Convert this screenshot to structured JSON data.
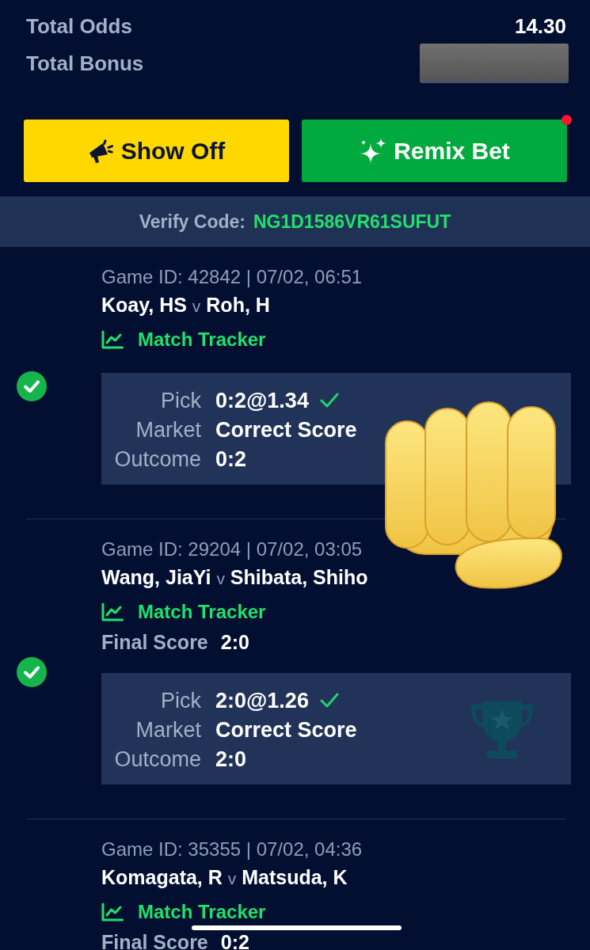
{
  "summary": [
    {
      "label": "Total Odds",
      "value": "14.30",
      "redacted": false
    },
    {
      "label": "Total Bonus",
      "redacted": true
    }
  ],
  "actions": [
    {
      "kind": "share",
      "label": "Show Off",
      "notification": false
    },
    {
      "kind": "remix",
      "label": "Remix Bet",
      "notification": true
    }
  ],
  "verify": {
    "label": "Verify Code:",
    "code": "NG1D1586VR61SUFUT"
  },
  "games": [
    {
      "game_id": "Game ID: 42842 | 07/02, 06:51",
      "home": "Koay, HS",
      "versus": "v",
      "away": "Roh, H",
      "tracker": "Match Tracker",
      "won": true,
      "selection": {
        "trophy": false,
        "pick": {
          "label": "Pick",
          "value": "0:2@1.34",
          "correct": true
        },
        "market": {
          "label": "Market",
          "value": "Correct Score"
        },
        "outcome": {
          "label": "Outcome",
          "value": "0:2"
        }
      }
    },
    {
      "game_id": "Game ID: 29204 | 07/02, 03:05",
      "home": "Wang, JiaYi",
      "versus": "v",
      "away": "Shibata, Shiho",
      "tracker": "Match Tracker",
      "final_score": {
        "label": "Final Score",
        "value": "2:0"
      },
      "won": true,
      "selection": {
        "trophy": true,
        "pick": {
          "label": "Pick",
          "value": "2:0@1.26",
          "correct": true
        },
        "market": {
          "label": "Market",
          "value": "Correct Score"
        },
        "outcome": {
          "label": "Outcome",
          "value": "2:0"
        }
      }
    },
    {
      "game_id": "Game ID: 35355 | 07/02, 04:36",
      "home": "Komagata, R",
      "versus": "v",
      "away": "Matsuda, K",
      "tracker": "Match Tracker",
      "final_score": {
        "label": "Final Score",
        "value": "0:2"
      },
      "won": false
    }
  ],
  "sticker": {
    "kind": "fist"
  }
}
